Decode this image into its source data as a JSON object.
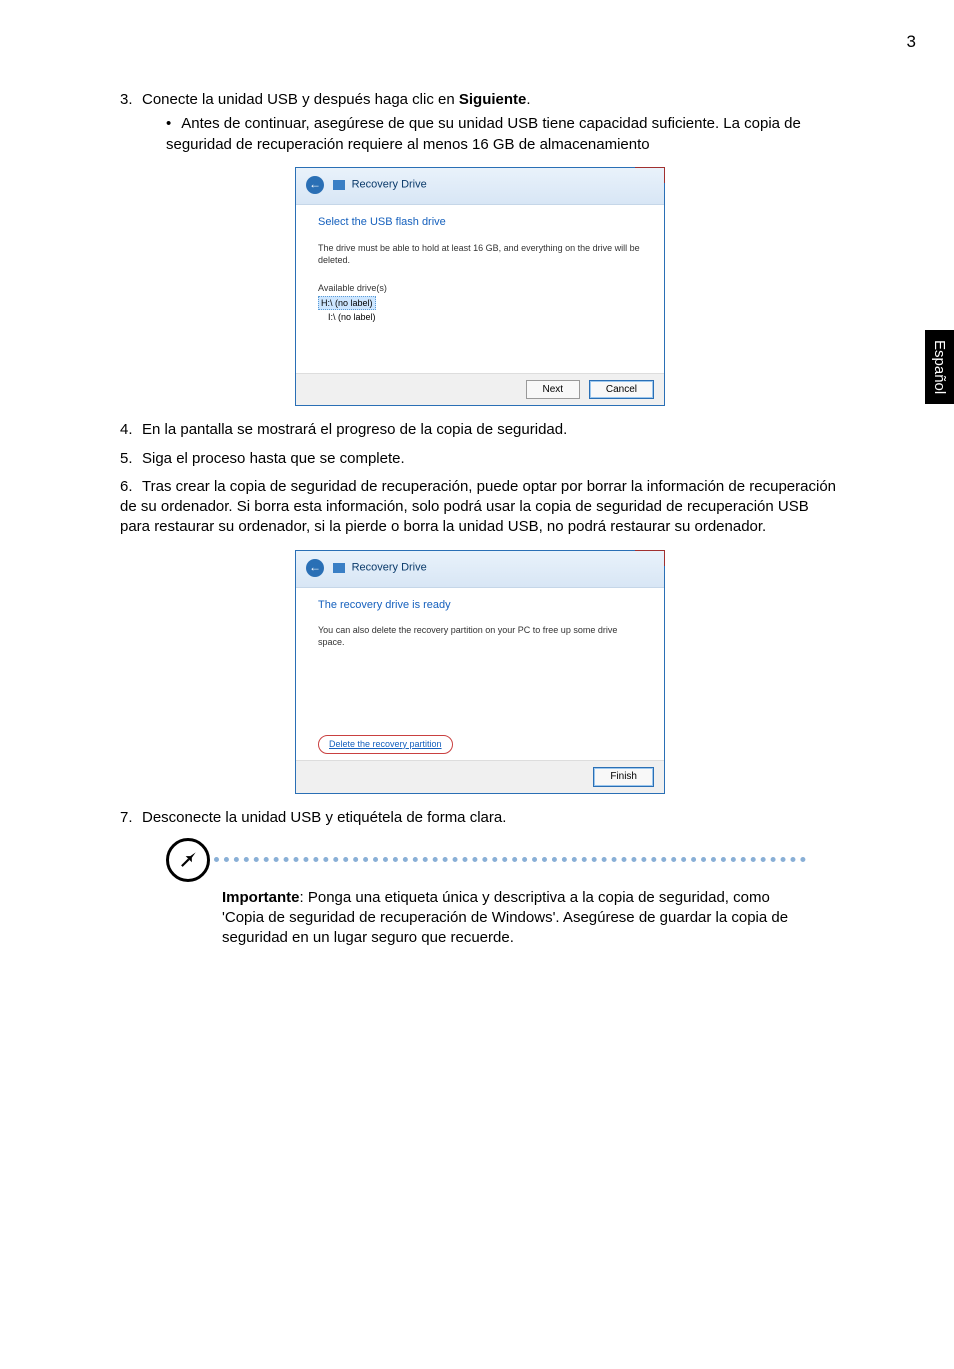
{
  "page_number": "3",
  "side_tab": "Español",
  "steps": {
    "s3": {
      "num": "3.",
      "text_pre": "Conecte la unidad USB y después haga clic en ",
      "bold": "Siguiente",
      "text_post": ".",
      "bullet": "Antes de continuar, asegúrese de que su unidad USB tiene capacidad suficiente. La copia de seguridad de recuperación requiere al menos 16 GB de almacenamiento"
    },
    "s4": {
      "num": "4.",
      "text": "En la pantalla se mostrará el progreso de la copia de seguridad."
    },
    "s5": {
      "num": "5.",
      "text": "Siga el proceso hasta que se complete."
    },
    "s6": {
      "num": "6.",
      "text": "Tras crear la copia de seguridad de recuperación, puede optar por borrar la información de recuperación de su ordenador. Si borra esta información, solo podrá usar la copia de seguridad de recuperación USB para restaurar su ordenador, si la pierde o borra la unidad USB, no podrá restaurar su ordenador."
    },
    "s7": {
      "num": "7.",
      "text": "Desconecte la unidad USB y etiquétela de forma clara."
    }
  },
  "dialog1": {
    "title": "Recovery Drive",
    "heading": "Select the USB flash drive",
    "desc": "The drive must be able to hold at least 16 GB, and everything on the drive will be deleted.",
    "drives_label": "Available drive(s)",
    "drive_h": "H:\\ (no label)",
    "drive_i": "I:\\ (no label)",
    "next": "Next",
    "cancel": "Cancel",
    "close": "×",
    "back": "←"
  },
  "dialog2": {
    "title": "Recovery Drive",
    "heading": "The recovery drive is ready",
    "desc": "You can also delete the recovery partition on your PC to free up some drive space.",
    "link": "Delete the recovery partition",
    "finish": "Finish",
    "close": "×",
    "back": "←"
  },
  "note": {
    "bold": "Importante",
    "text": ": Ponga una etiqueta única y descriptiva a la copia de seguridad, como 'Copia de seguridad de recuperación de Windows'. Asegúrese de guardar la copia de seguridad en un lugar seguro que recuerde."
  }
}
